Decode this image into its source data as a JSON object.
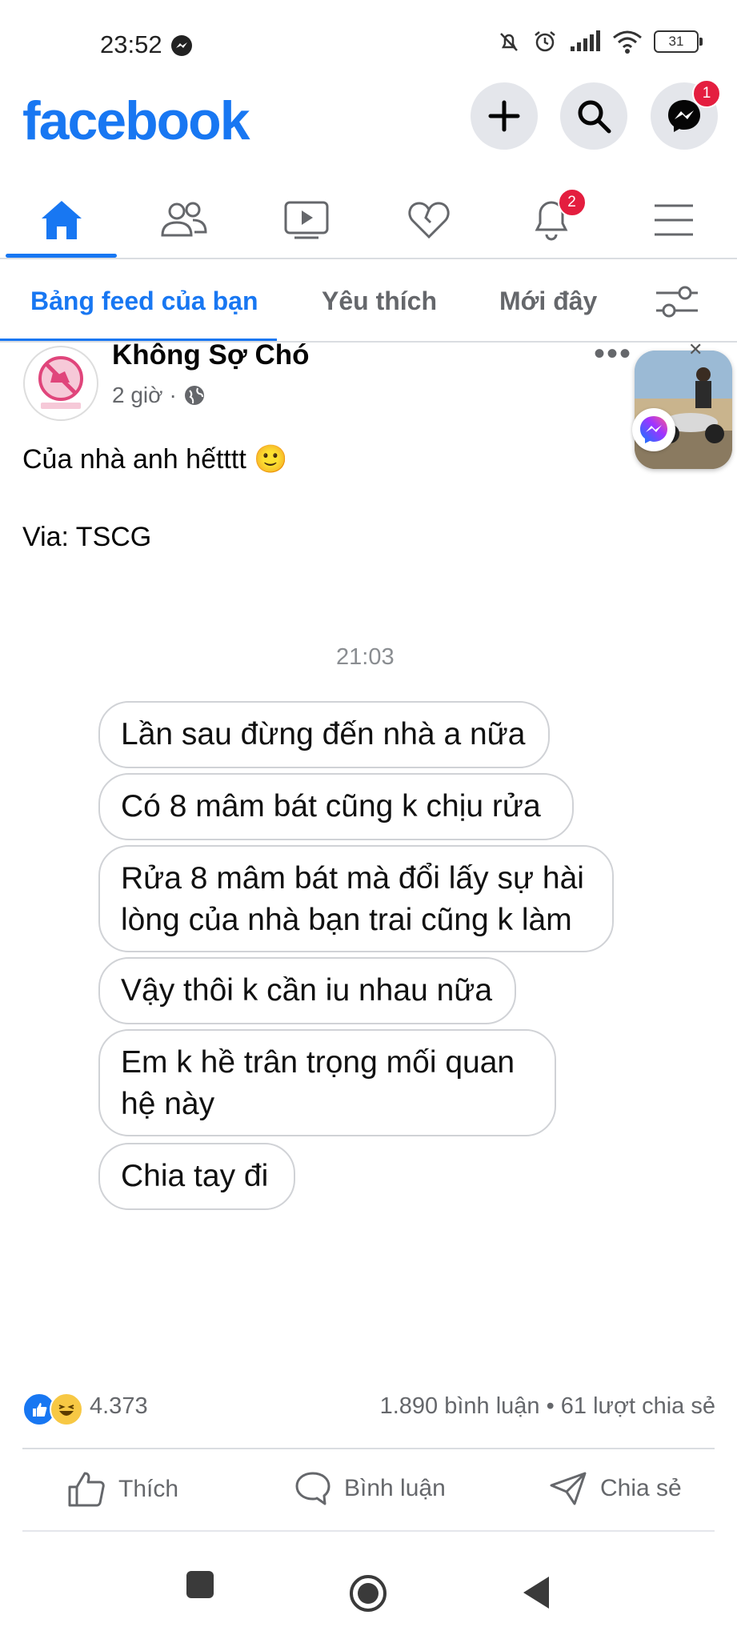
{
  "status_bar": {
    "time": "23:52",
    "battery": "31",
    "icons": [
      "messenger-icon",
      "mute-bell-icon",
      "alarm-icon",
      "signal-icon",
      "wifi-icon",
      "battery-icon"
    ]
  },
  "header": {
    "logo": "facebook",
    "messenger_badge": "1",
    "buttons": [
      "plus-icon",
      "search-icon",
      "messenger-icon"
    ]
  },
  "nav": {
    "tabs": [
      "home-icon",
      "friends-icon",
      "video-icon",
      "dating-heart-icon",
      "notifications-bell-icon",
      "menu-icon"
    ],
    "notifications_badge": "2"
  },
  "feed_tabs": {
    "items": [
      "Bảng feed của bạn",
      "Yêu thích",
      "Mới đây"
    ],
    "active": "Bảng feed của bạn"
  },
  "post": {
    "page_name": "Không Sợ Chó",
    "time": "2 giờ",
    "separator": "·",
    "text_line1": "Của nhà anh hếtttt 🙂",
    "text_line2": "Via: TSCG",
    "chat_time": "21:03",
    "messages": [
      "Lần sau đừng đến nhà a nữa",
      "Có 8 mâm bát cũng k chịu rửa",
      "Rửa 8 mâm bát mà đổi lấy sự hài lòng của nhà bạn trai cũng k làm",
      "Vậy thôi k cần iu nhau nữa",
      "Em k hề trân trọng mối quan hệ này",
      "Chia tay đi"
    ],
    "reactions_count": "4.373",
    "comments_shares": "1.890 bình luận • 61 lượt chia sẻ",
    "actions": {
      "like": "Thích",
      "comment": "Bình luận",
      "share": "Chia sẻ"
    }
  },
  "colors": {
    "brand": "#1877f2",
    "badge": "#e41e3f",
    "secondary_text": "#65676b"
  }
}
